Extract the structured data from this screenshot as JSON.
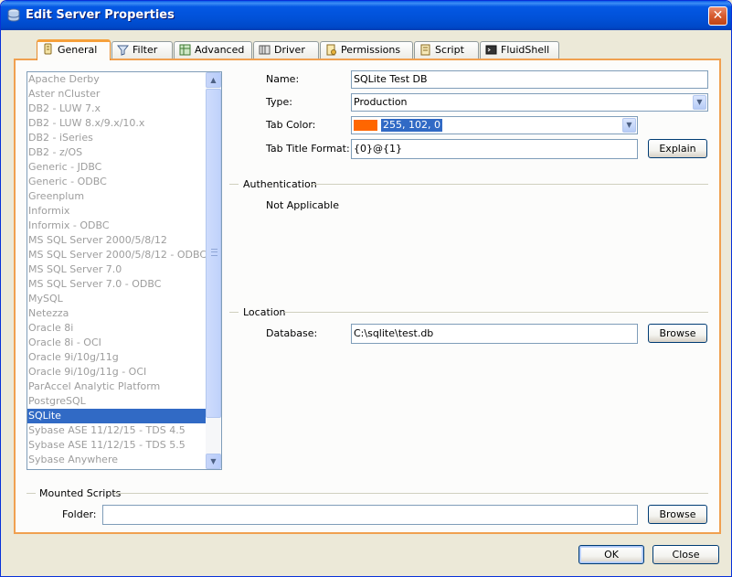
{
  "window": {
    "title": "Edit Server Properties",
    "close_glyph": "✕"
  },
  "tabs": [
    {
      "label": "General",
      "icon": "general-icon"
    },
    {
      "label": "Filter",
      "icon": "filter-icon"
    },
    {
      "label": "Advanced",
      "icon": "advanced-icon"
    },
    {
      "label": "Driver",
      "icon": "driver-icon"
    },
    {
      "label": "Permissions",
      "icon": "permissions-icon"
    },
    {
      "label": "Script",
      "icon": "script-icon"
    },
    {
      "label": "FluidShell",
      "icon": "fluidshell-icon"
    }
  ],
  "database_types": [
    "Apache Derby",
    "Aster nCluster",
    "DB2 - LUW 7.x",
    "DB2 - LUW 8.x/9.x/10.x",
    "DB2 - iSeries",
    "DB2 - z/OS",
    "Generic - JDBC",
    "Generic - ODBC",
    "Greenplum",
    "Informix",
    "Informix - ODBC",
    "MS SQL Server 2000/5/8/12",
    "MS SQL Server 2000/5/8/12 - ODBC",
    "MS SQL Server 7.0",
    "MS SQL Server 7.0 - ODBC",
    "MySQL",
    "Netezza",
    "Oracle 8i",
    "Oracle 8i - OCI",
    "Oracle 9i/10g/11g",
    "Oracle 9i/10g/11g - OCI",
    "ParAccel Analytic Platform",
    "PostgreSQL",
    "SQLite",
    "Sybase ASE 11/12/15 - TDS 4.5",
    "Sybase ASE 11/12/15 - TDS 5.5",
    "Sybase Anywhere"
  ],
  "selected_database": "SQLite",
  "form": {
    "name_label": "Name:",
    "name_value": "SQLite Test DB",
    "type_label": "Type:",
    "type_value": "Production",
    "tab_color_label": "Tab Color:",
    "tab_color_value": "255, 102, 0",
    "tab_color_hex": "#ff6600",
    "tab_title_label": "Tab Title Format:",
    "tab_title_value": "{0}@{1}",
    "explain_label": "Explain"
  },
  "authentication": {
    "heading": "Authentication",
    "text": "Not Applicable"
  },
  "location": {
    "heading": "Location",
    "database_label": "Database:",
    "database_value": "C:\\sqlite\\test.db",
    "browse_label": "Browse"
  },
  "mounted_scripts": {
    "heading": "Mounted Scripts",
    "folder_label": "Folder:",
    "folder_value": "",
    "browse_label": "Browse"
  },
  "footer": {
    "ok_label": "OK",
    "close_label": "Close"
  }
}
